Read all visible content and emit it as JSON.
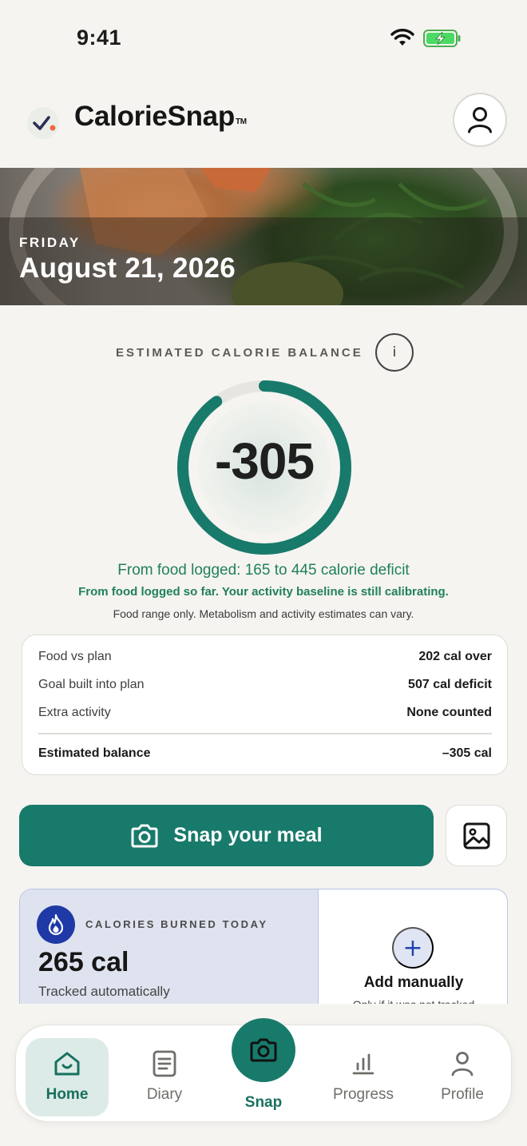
{
  "status_bar": {
    "time": "9:41"
  },
  "header": {
    "app_name": "CalorieSnap",
    "trademark": "TM"
  },
  "hero": {
    "day": "FRIDAY",
    "date": "August 21, 2026"
  },
  "balance": {
    "label": "ESTIMATED CALORIE BALANCE",
    "info": "i",
    "value": "-305",
    "ring_fraction": 0.9,
    "food_range": "From food logged: 165 to 445 calorie deficit",
    "calibrating": "From food logged so far. Your activity baseline is still calibrating.",
    "disclaimer": "Food range only. Metabolism and activity estimates can vary."
  },
  "breakdown": {
    "rows": [
      {
        "label": "Food vs plan",
        "value": "202 cal over"
      },
      {
        "label": "Goal built into plan",
        "value": "507 cal deficit"
      },
      {
        "label": "Extra activity",
        "value": "None counted"
      }
    ],
    "total": {
      "label": "Estimated balance",
      "value": "–305 cal"
    }
  },
  "actions": {
    "snap_label": "Snap your meal"
  },
  "burned": {
    "label": "CALORIES BURNED TODAY",
    "value": "265 cal",
    "sub": "Tracked automatically",
    "add_label": "Add manually",
    "add_sub": "Only if it was not tracked"
  },
  "tabs": {
    "home": "Home",
    "diary": "Diary",
    "snap": "Snap",
    "progress": "Progress",
    "profile": "Profile"
  },
  "colors": {
    "accent": "#187a6b",
    "accent_text": "#21805c",
    "burn_card": "#dfe3ef",
    "burn_icon": "#1f3aa6"
  },
  "icons": {
    "profile": "person-icon",
    "info": "info-icon",
    "snap": "camera-icon",
    "gallery": "image-icon",
    "burned": "flame-icon",
    "add": "plus-icon"
  }
}
